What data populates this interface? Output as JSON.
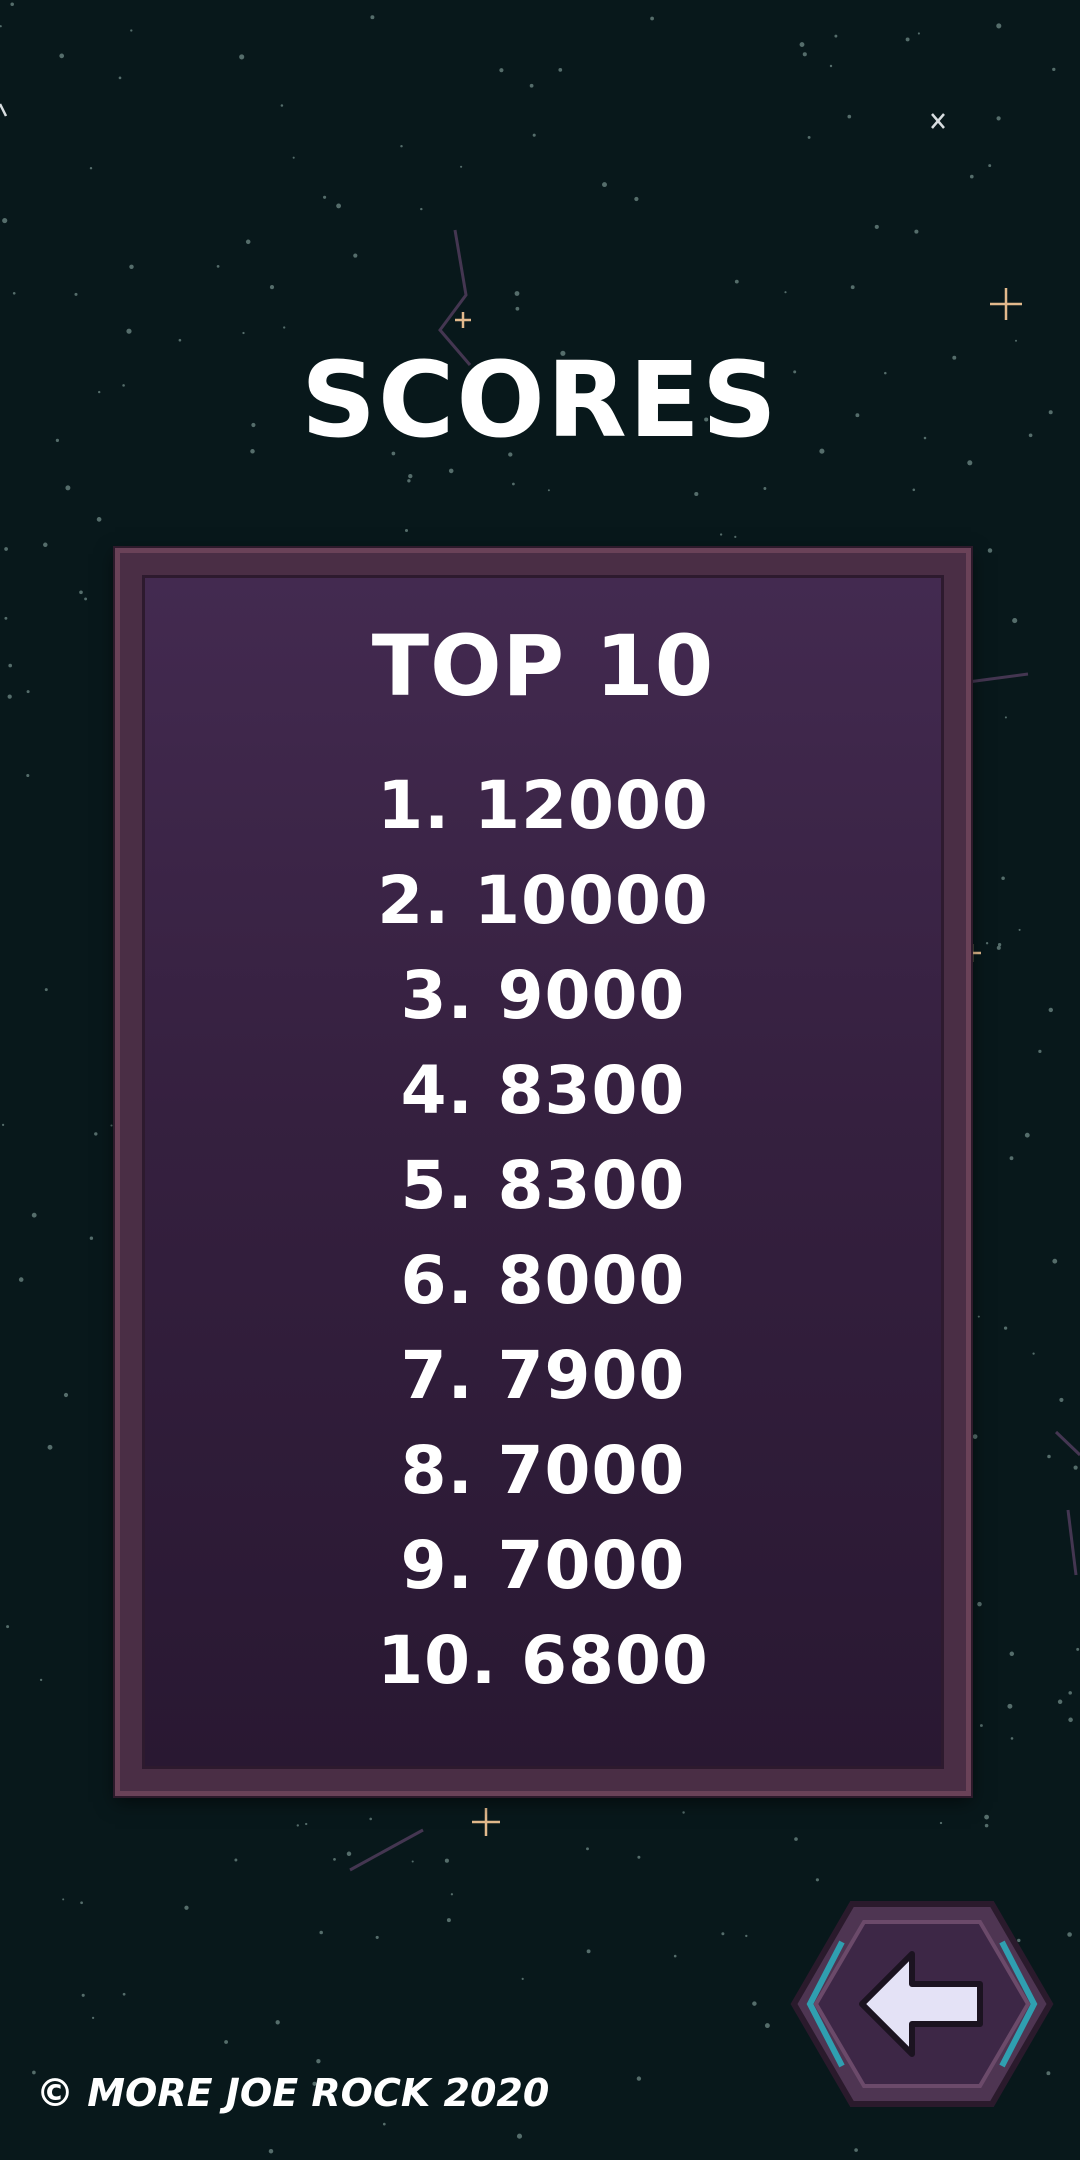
{
  "screen": {
    "title": "SCORES",
    "background_color": "#08181b"
  },
  "leaderboard": {
    "heading": "TOP 10",
    "entries": [
      {
        "label": "1. 12000",
        "rank": 1,
        "score": 12000
      },
      {
        "label": "2. 10000",
        "rank": 2,
        "score": 10000
      },
      {
        "label": "3. 9000",
        "rank": 3,
        "score": 9000
      },
      {
        "label": "4. 8300",
        "rank": 4,
        "score": 8300
      },
      {
        "label": "5. 8300",
        "rank": 5,
        "score": 8300
      },
      {
        "label": "6. 8000",
        "rank": 6,
        "score": 8000
      },
      {
        "label": "7. 7900",
        "rank": 7,
        "score": 7900
      },
      {
        "label": "8. 7000",
        "rank": 8,
        "score": 7000
      },
      {
        "label": "9. 7000",
        "rank": 9,
        "score": 7000
      },
      {
        "label": "10. 6800",
        "rank": 10,
        "score": 6800
      }
    ],
    "frame_color": "#6a4258",
    "panel_color": "#3a2345"
  },
  "back_button": {
    "icon": "back-arrow-icon",
    "hex_color": "#4e3552",
    "accent_color": "#2f9fb0"
  },
  "footer": {
    "copyright": "© MORE JOE ROCK 2020"
  }
}
